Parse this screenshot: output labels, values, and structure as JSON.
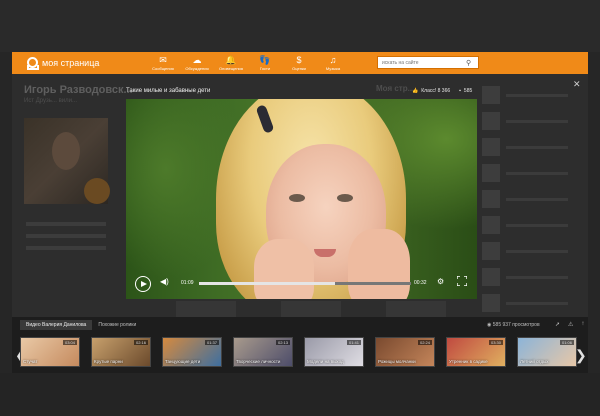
{
  "topbar": {
    "logo": "моя страница",
    "nav": [
      {
        "label": "Сообщения",
        "icon": "envelope-icon",
        "glyph": "✉"
      },
      {
        "label": "Обсуждения",
        "icon": "discussions-icon",
        "glyph": "☁"
      },
      {
        "label": "Оповещения",
        "icon": "bell-icon",
        "glyph": "🔔"
      },
      {
        "label": "Гости",
        "icon": "footprints-icon",
        "glyph": "👣"
      },
      {
        "label": "Оценки",
        "icon": "rating-icon",
        "glyph": "$"
      },
      {
        "label": "Музыка",
        "icon": "music-icon",
        "glyph": "♫"
      }
    ],
    "search_placeholder": "искать на сайте"
  },
  "page": {
    "profile_name": "Игорь Разводовск...",
    "profile_menu": "Ист   Друзь...   вили...",
    "my_page": "Моя стр..."
  },
  "video": {
    "title": "Такие милые и забавные дети",
    "likes": "Класс! 8 366",
    "comments": "585",
    "time_current": "01:09",
    "time_total": "00:32",
    "progress": 0.64
  },
  "strip": {
    "tabs": [
      "Видео Валерия Данилова",
      "Похожие ролики"
    ],
    "views": "585 937 просмотров",
    "thumbnails": [
      {
        "label": "Стучат",
        "duration": "03:04",
        "colors": [
          "#e9c9a6",
          "#c58a5e"
        ]
      },
      {
        "label": "Крутые парни",
        "duration": "02:16",
        "colors": [
          "#c7a06c",
          "#6b4a2c"
        ]
      },
      {
        "label": "Танцующие дети",
        "duration": "01:37",
        "colors": [
          "#d58a3f",
          "#3e6fa0"
        ]
      },
      {
        "label": "Творческие личности",
        "duration": "02:13",
        "colors": [
          "#a89a8c",
          "#4d4d6a"
        ]
      },
      {
        "label": "Модели на выход",
        "duration": "01:41",
        "colors": [
          "#9a9aa8",
          "#dfdde3"
        ]
      },
      {
        "label": "Рожицы молчанки",
        "duration": "02:24",
        "colors": [
          "#7a4a2f",
          "#c4855a"
        ]
      },
      {
        "label": "Утренник в садике",
        "duration": "03:30",
        "colors": [
          "#c04a40",
          "#e0b060"
        ]
      },
      {
        "label": "Летний отдых",
        "duration": "01:06",
        "colors": [
          "#8cb4d8",
          "#e7c7a7"
        ]
      }
    ]
  }
}
